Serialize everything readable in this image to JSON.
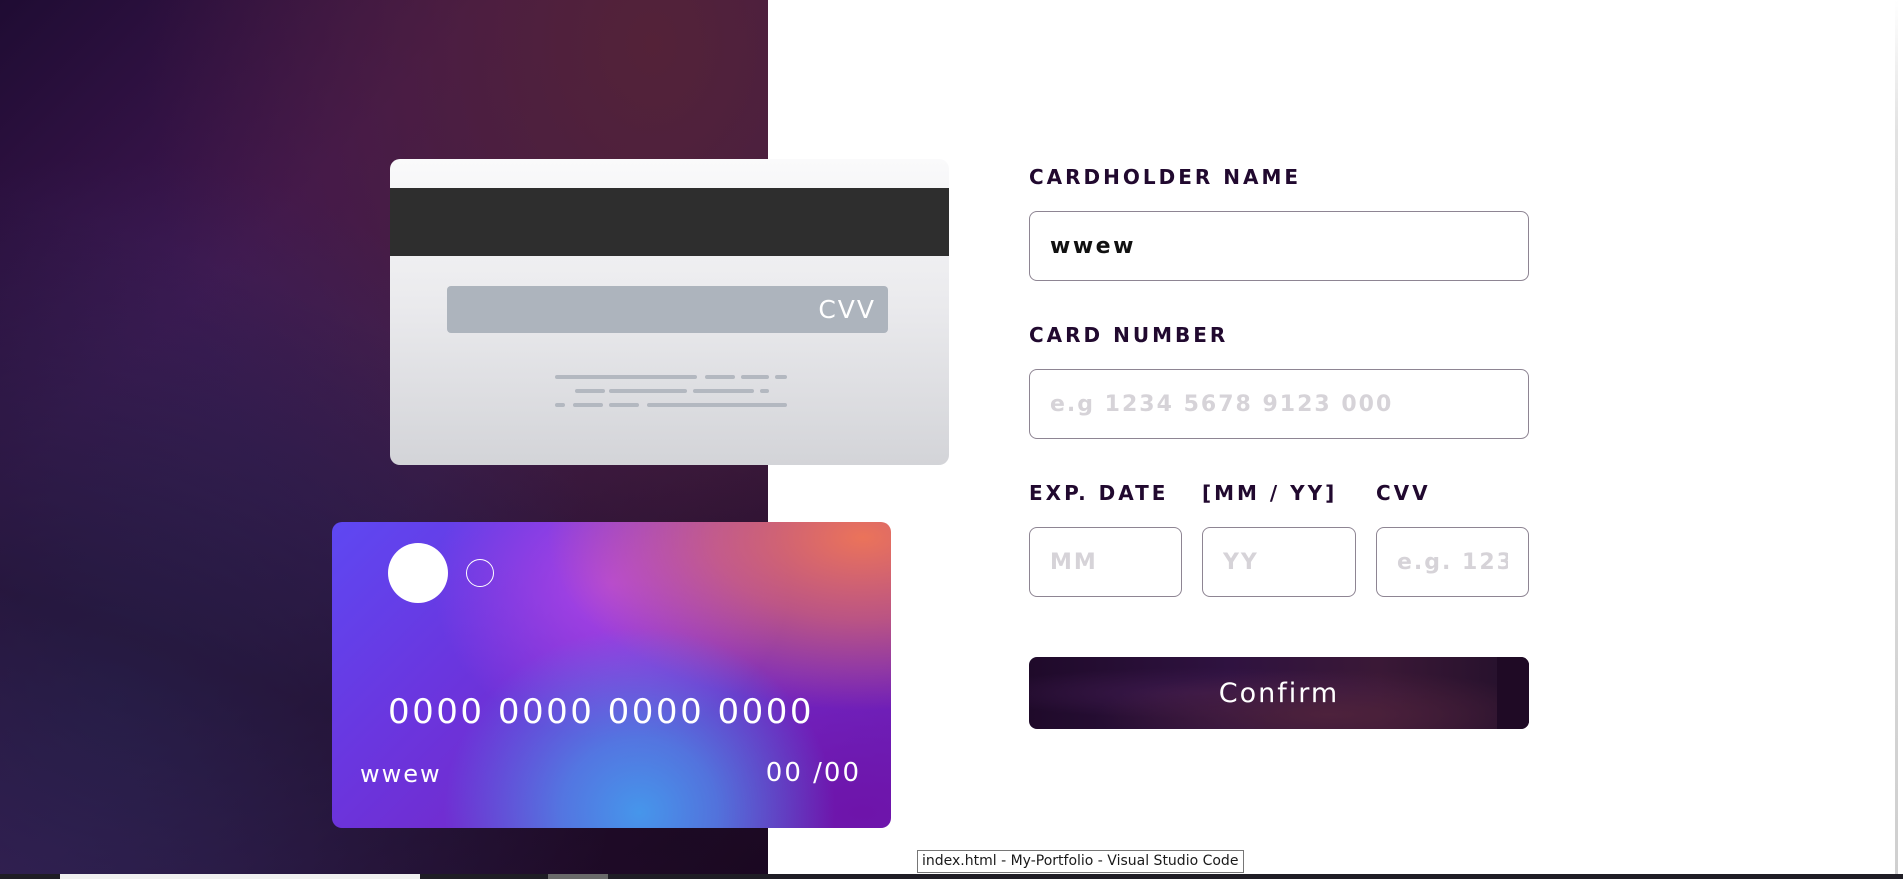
{
  "card_back": {
    "cvv_label": "CVV"
  },
  "card_front": {
    "number": "0000 0000 0000 0000",
    "name": "wwew",
    "expiry": "00 /00"
  },
  "form": {
    "cardholder_label": "CARDHOLDER NAME",
    "cardholder_value": "wwew",
    "card_number_label": "CARD NUMBER",
    "card_number_placeholder": "e.g 1234 5678 9123 000",
    "exp_date_label": "EXP. DATE",
    "exp_format_label": "[MM / YY]",
    "cvv_label": "CVV",
    "month_placeholder": "MM",
    "year_placeholder": "YY",
    "cvv_placeholder": "e.g. 123",
    "confirm_label": "Confirm"
  },
  "tooltip": {
    "text": "index.html - My-Portfolio - Visual Studio Code"
  },
  "colors": {
    "label_text": "#21092f",
    "input_border": "#8e8593",
    "placeholder": "#d6d3d8",
    "card_back_stripe": "#2e2e2e",
    "cvv_box": "#adb4bd"
  }
}
